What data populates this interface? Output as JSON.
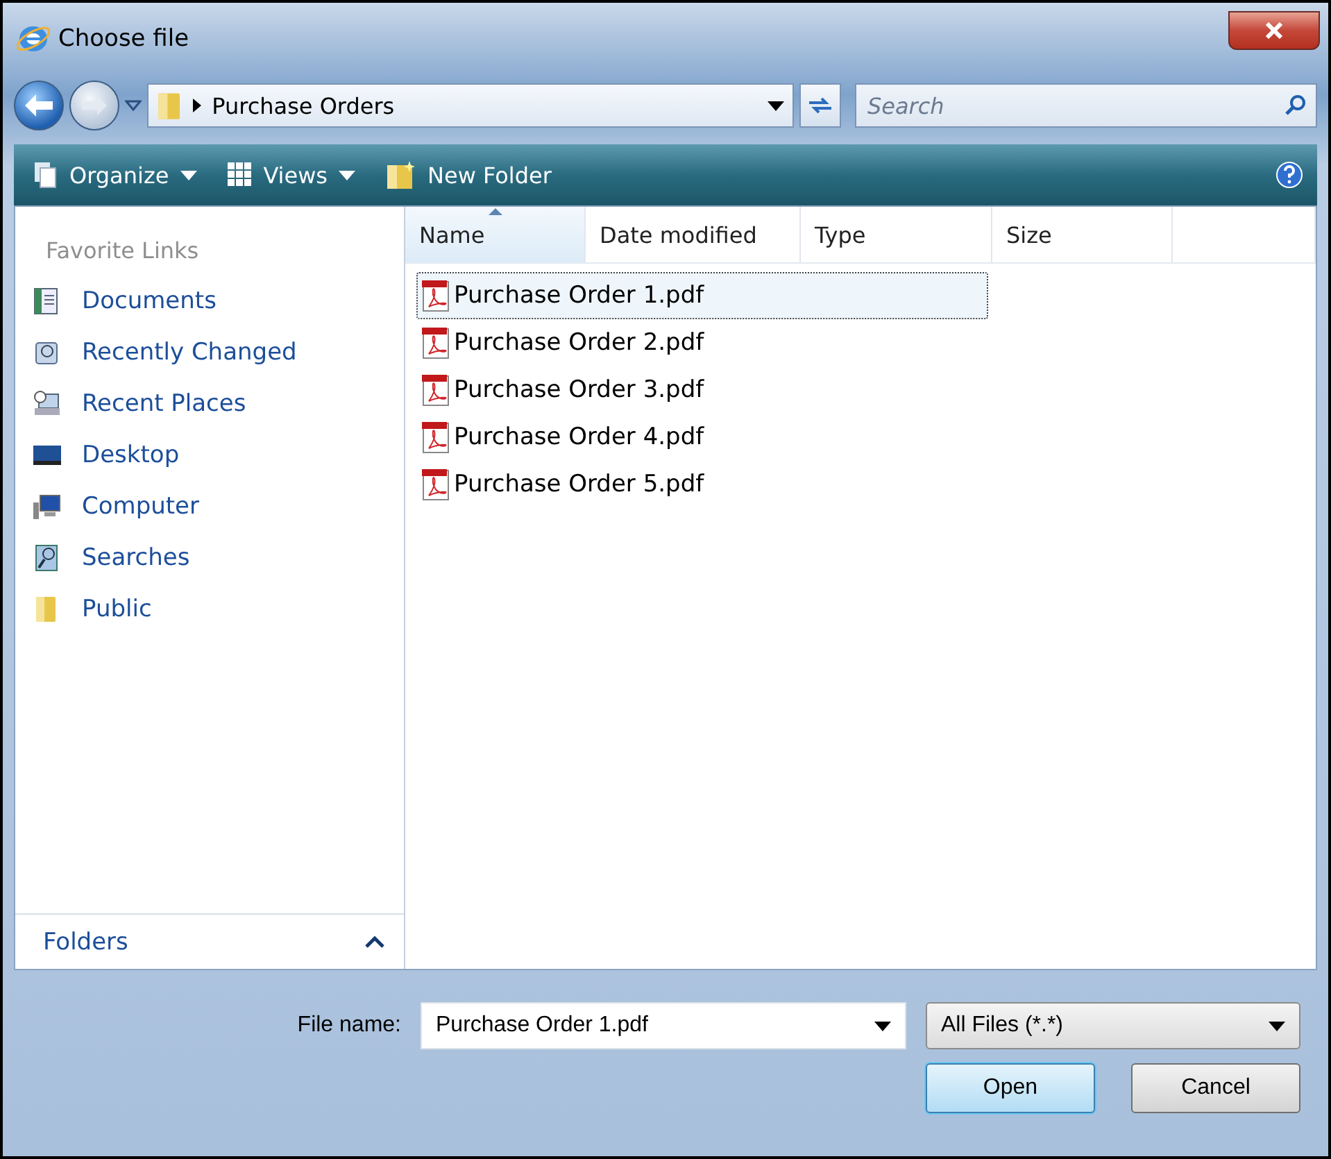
{
  "window": {
    "title": "Choose file"
  },
  "address": {
    "path": "Purchase Orders"
  },
  "search": {
    "placeholder": "Search"
  },
  "toolbar": [
    {
      "label": "Organize",
      "kind": "organize"
    },
    {
      "label": "Views",
      "kind": "views"
    },
    {
      "label": "New Folder",
      "kind": "newfolder"
    }
  ],
  "sidebar": {
    "header": "Favorite Links",
    "items": [
      {
        "label": "Documents",
        "kind": "documents"
      },
      {
        "label": "Recently Changed",
        "kind": "recent"
      },
      {
        "label": "Recent Places",
        "kind": "places"
      },
      {
        "label": "Desktop",
        "kind": "desktop"
      },
      {
        "label": "Computer",
        "kind": "computer"
      },
      {
        "label": "Searches",
        "kind": "searches"
      },
      {
        "label": "Public",
        "kind": "public"
      }
    ],
    "folders": "Folders"
  },
  "table": {
    "columns": [
      {
        "label": "Name",
        "sorted": true
      },
      {
        "label": "Date modified",
        "sorted": false
      },
      {
        "label": "Type",
        "sorted": false
      },
      {
        "label": "Size",
        "sorted": false
      }
    ],
    "rows": [
      {
        "name": "Purchase Order 1.pdf",
        "selected": true
      },
      {
        "name": "Purchase Order 2.pdf",
        "selected": false
      },
      {
        "name": "Purchase Order 3.pdf",
        "selected": false
      },
      {
        "name": "Purchase Order 4.pdf",
        "selected": false
      },
      {
        "name": "Purchase Order 5.pdf",
        "selected": false
      }
    ]
  },
  "footer": {
    "file_name_label": "File name:",
    "file_name": "Purchase Order 1.pdf",
    "filter": "All Files (*.*)",
    "buttons": [
      {
        "label": "Open",
        "kind": "default"
      },
      {
        "label": "Cancel",
        "kind": "normal"
      }
    ]
  }
}
